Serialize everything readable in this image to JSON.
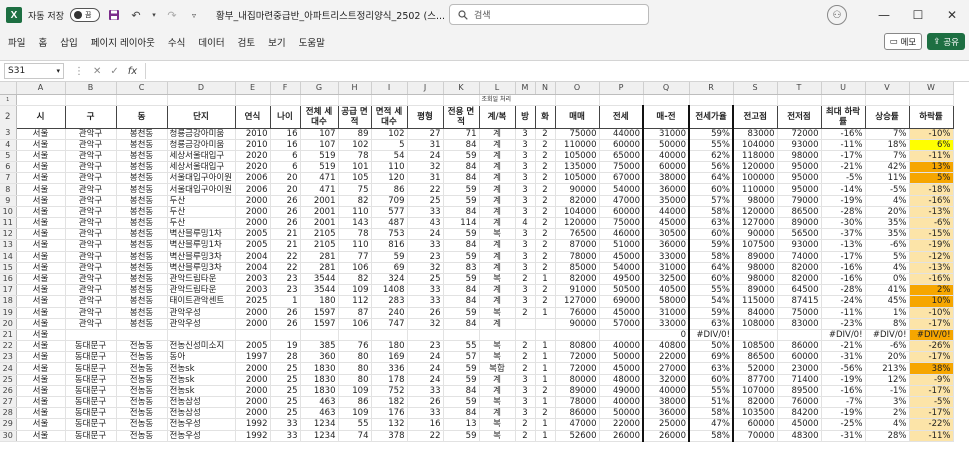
{
  "titlebar": {
    "app_icon": "X",
    "autosave_label": "자동 저장",
    "autosave_state": "끔",
    "doc_title": "황부_내집마련중급반_아파트리스트정리양식_2502 (스...",
    "search_placeholder": "검색"
  },
  "menu": [
    "파일",
    "홈",
    "삽입",
    "페이지 레이아웃",
    "수식",
    "데이터",
    "검토",
    "보기",
    "도움말"
  ],
  "menu_right": {
    "memo": "메모",
    "share": "공유"
  },
  "formula": {
    "namebox": "S31",
    "fx": "fx",
    "content": ""
  },
  "columns": [
    "A",
    "B",
    "C",
    "D",
    "E",
    "F",
    "G",
    "H",
    "I",
    "J",
    "K",
    "L",
    "M",
    "N",
    "O",
    "P",
    "Q",
    "R",
    "S",
    "T",
    "U",
    "V",
    "W"
  ],
  "partial_row1": "조회일 처리",
  "header_row": [
    "시",
    "구",
    "동",
    "단지",
    "연식",
    "나이",
    "전체 세대수",
    "공급 면적",
    "면적 세대수",
    "평형",
    "전용 면적",
    "계/복",
    "방",
    "화",
    "매매",
    "전세",
    "매-전",
    "전세가율",
    "전고점",
    "전저점",
    "최대 하락률",
    "상승률",
    "하락률"
  ],
  "rows": [
    {
      "n": "3",
      "v": [
        "서울",
        "관악구",
        "봉천동",
        "청룡금강아미움",
        "2010",
        "16",
        "107",
        "89",
        "102",
        "27",
        "71",
        "계",
        "3",
        "2",
        "75000",
        "44000",
        "31000",
        "59%",
        "83000",
        "72000",
        "-16%",
        "7%",
        "-10%"
      ]
    },
    {
      "n": "4",
      "v": [
        "서울",
        "관악구",
        "봉천동",
        "청룡금강아미움",
        "2010",
        "16",
        "107",
        "102",
        "5",
        "31",
        "84",
        "계",
        "3",
        "2",
        "110000",
        "60000",
        "50000",
        "55%",
        "104000",
        "93000",
        "-11%",
        "18%",
        "6%"
      ]
    },
    {
      "n": "5",
      "v": [
        "서울",
        "관악구",
        "봉천동",
        "세상서울대입구",
        "2020",
        "6",
        "519",
        "78",
        "54",
        "24",
        "59",
        "계",
        "3",
        "2",
        "105000",
        "65000",
        "40000",
        "62%",
        "118000",
        "98000",
        "-17%",
        "7%",
        "-11%"
      ]
    },
    {
      "n": "6",
      "v": [
        "서울",
        "관악구",
        "봉천동",
        "세상서울대입구",
        "2020",
        "6",
        "519",
        "101",
        "110",
        "32",
        "84",
        "계",
        "3",
        "2",
        "135000",
        "75000",
        "60000",
        "56%",
        "120000",
        "95000",
        "-21%",
        "42%",
        "13%"
      ]
    },
    {
      "n": "7",
      "v": [
        "서울",
        "관악구",
        "봉천동",
        "서울대입구아이원",
        "2006",
        "20",
        "471",
        "105",
        "120",
        "31",
        "84",
        "계",
        "3",
        "2",
        "105000",
        "67000",
        "38000",
        "64%",
        "100000",
        "95000",
        "-5%",
        "11%",
        "5%"
      ]
    },
    {
      "n": "8",
      "v": [
        "서울",
        "관악구",
        "봉천동",
        "서울대입구아이원",
        "2006",
        "20",
        "471",
        "75",
        "86",
        "22",
        "59",
        "계",
        "3",
        "2",
        "90000",
        "54000",
        "36000",
        "60%",
        "110000",
        "95000",
        "-14%",
        "-5%",
        "-18%"
      ]
    },
    {
      "n": "9",
      "v": [
        "서울",
        "관악구",
        "봉천동",
        "두산",
        "2000",
        "26",
        "2001",
        "82",
        "709",
        "25",
        "59",
        "계",
        "3",
        "2",
        "82000",
        "47000",
        "35000",
        "57%",
        "98000",
        "79000",
        "-19%",
        "4%",
        "-16%"
      ]
    },
    {
      "n": "10",
      "v": [
        "서울",
        "관악구",
        "봉천동",
        "두산",
        "2000",
        "26",
        "2001",
        "110",
        "577",
        "33",
        "84",
        "계",
        "3",
        "2",
        "104000",
        "60000",
        "44000",
        "58%",
        "120000",
        "86500",
        "-28%",
        "20%",
        "-13%"
      ]
    },
    {
      "n": "11",
      "v": [
        "서울",
        "관악구",
        "봉천동",
        "두산",
        "2000",
        "26",
        "2001",
        "143",
        "487",
        "43",
        "114",
        "계",
        "4",
        "2",
        "120000",
        "75000",
        "45000",
        "63%",
        "127000",
        "89000",
        "-30%",
        "35%",
        "-6%"
      ]
    },
    {
      "n": "12",
      "v": [
        "서울",
        "관악구",
        "봉천동",
        "벽산블루밍1차",
        "2005",
        "21",
        "2105",
        "78",
        "753",
        "24",
        "59",
        "복",
        "3",
        "2",
        "76500",
        "46000",
        "30500",
        "60%",
        "90000",
        "56500",
        "-37%",
        "35%",
        "-15%"
      ]
    },
    {
      "n": "13",
      "v": [
        "서울",
        "관악구",
        "봉천동",
        "벽산블루밍1차",
        "2005",
        "21",
        "2105",
        "110",
        "816",
        "33",
        "84",
        "계",
        "3",
        "2",
        "87000",
        "51000",
        "36000",
        "59%",
        "107500",
        "93000",
        "-13%",
        "-6%",
        "-19%"
      ]
    },
    {
      "n": "14",
      "v": [
        "서울",
        "관악구",
        "봉천동",
        "벽산블루밍3차",
        "2004",
        "22",
        "281",
        "77",
        "59",
        "23",
        "59",
        "계",
        "3",
        "2",
        "78000",
        "45000",
        "33000",
        "58%",
        "89000",
        "74000",
        "-17%",
        "5%",
        "-12%"
      ]
    },
    {
      "n": "15",
      "v": [
        "서울",
        "관악구",
        "봉천동",
        "벽산블루밍3차",
        "2004",
        "22",
        "281",
        "106",
        "69",
        "32",
        "83",
        "계",
        "3",
        "2",
        "85000",
        "54000",
        "31000",
        "64%",
        "98000",
        "82000",
        "-16%",
        "4%",
        "-13%"
      ]
    },
    {
      "n": "16",
      "v": [
        "서울",
        "관악구",
        "봉천동",
        "관악드림타운",
        "2003",
        "23",
        "3544",
        "82",
        "324",
        "25",
        "59",
        "복",
        "2",
        "1",
        "82000",
        "49500",
        "32500",
        "60%",
        "98000",
        "82000",
        "-16%",
        "0%",
        "-16%"
      ]
    },
    {
      "n": "17",
      "v": [
        "서울",
        "관악구",
        "봉천동",
        "관악드림타운",
        "2003",
        "23",
        "3544",
        "109",
        "1408",
        "33",
        "84",
        "계",
        "3",
        "2",
        "91000",
        "50500",
        "40500",
        "55%",
        "89000",
        "64500",
        "-28%",
        "41%",
        "2%"
      ]
    },
    {
      "n": "18",
      "v": [
        "서울",
        "관악구",
        "봉천동",
        "태이트관악센트",
        "2025",
        "1",
        "180",
        "112",
        "283",
        "33",
        "84",
        "계",
        "3",
        "2",
        "127000",
        "69000",
        "58000",
        "54%",
        "115000",
        "87415",
        "-24%",
        "45%",
        "10%"
      ]
    },
    {
      "n": "19",
      "v": [
        "서울",
        "관악구",
        "봉천동",
        "관악우성",
        "2000",
        "26",
        "1597",
        "87",
        "240",
        "26",
        "59",
        "복",
        "2",
        "1",
        "76000",
        "45000",
        "31000",
        "59%",
        "84000",
        "75000",
        "-11%",
        "1%",
        "-10%"
      ]
    },
    {
      "n": "20",
      "v": [
        "서울",
        "관악구",
        "봉천동",
        "관악우성",
        "2000",
        "26",
        "1597",
        "106",
        "747",
        "32",
        "84",
        "계",
        "",
        "",
        "90000",
        "57000",
        "33000",
        "63%",
        "108000",
        "83000",
        "-23%",
        "8%",
        "-17%"
      ]
    },
    {
      "n": "21",
      "v": [
        "서울",
        "",
        "",
        "",
        "",
        "",
        "",
        "",
        "",
        "",
        "",
        "",
        "",
        "",
        "",
        "",
        "0",
        "#DIV/0!",
        "",
        "",
        "#DIV/0!",
        "#DIV/0!",
        "#DIV/0!"
      ]
    },
    {
      "n": "22",
      "v": [
        "서울",
        "동대문구",
        "전농동",
        "전농신성미소지",
        "2005",
        "19",
        "385",
        "76",
        "180",
        "23",
        "55",
        "복",
        "2",
        "1",
        "80800",
        "40000",
        "40800",
        "50%",
        "108500",
        "86000",
        "-21%",
        "-6%",
        "-26%"
      ]
    },
    {
      "n": "23",
      "v": [
        "서울",
        "동대문구",
        "전농동",
        "동아",
        "1997",
        "28",
        "360",
        "80",
        "169",
        "24",
        "57",
        "복",
        "2",
        "1",
        "72000",
        "50000",
        "22000",
        "69%",
        "86500",
        "60000",
        "-31%",
        "20%",
        "-17%"
      ]
    },
    {
      "n": "24",
      "v": [
        "서울",
        "동대문구",
        "전농동",
        "전농sk",
        "2000",
        "25",
        "1830",
        "80",
        "336",
        "24",
        "59",
        "복합",
        "2",
        "1",
        "72000",
        "45000",
        "27000",
        "63%",
        "52000",
        "23000",
        "-56%",
        "213%",
        "38%"
      ]
    },
    {
      "n": "25",
      "v": [
        "서울",
        "동대문구",
        "전농동",
        "전농sk",
        "2000",
        "25",
        "1830",
        "80",
        "178",
        "24",
        "59",
        "계",
        "3",
        "1",
        "80000",
        "48000",
        "32000",
        "60%",
        "87700",
        "71400",
        "-19%",
        "12%",
        "-9%"
      ]
    },
    {
      "n": "26",
      "v": [
        "서울",
        "동대문구",
        "전농동",
        "전농sk",
        "2000",
        "25",
        "1830",
        "109",
        "752",
        "33",
        "84",
        "계",
        "3",
        "2",
        "89000",
        "49000",
        "40000",
        "55%",
        "107000",
        "89500",
        "-16%",
        "-1%",
        "-17%"
      ]
    },
    {
      "n": "27",
      "v": [
        "서울",
        "동대문구",
        "전농동",
        "전농삼성",
        "2000",
        "25",
        "463",
        "86",
        "182",
        "26",
        "59",
        "복",
        "3",
        "1",
        "78000",
        "40000",
        "38000",
        "51%",
        "82000",
        "76000",
        "-7%",
        "3%",
        "-5%"
      ]
    },
    {
      "n": "28",
      "v": [
        "서울",
        "동대문구",
        "전농동",
        "전농삼성",
        "2000",
        "25",
        "463",
        "109",
        "176",
        "33",
        "84",
        "계",
        "3",
        "2",
        "86000",
        "50000",
        "36000",
        "58%",
        "103500",
        "84200",
        "-19%",
        "2%",
        "-17%"
      ]
    },
    {
      "n": "29",
      "v": [
        "서울",
        "동대문구",
        "전농동",
        "전농우성",
        "1992",
        "33",
        "1234",
        "55",
        "132",
        "16",
        "13",
        "복",
        "2",
        "1",
        "47000",
        "22000",
        "25000",
        "47%",
        "60000",
        "45000",
        "-25%",
        "4%",
        "-22%"
      ]
    },
    {
      "n": "30",
      "v": [
        "서울",
        "동대문구",
        "전농동",
        "전농우성",
        "1992",
        "33",
        "1234",
        "74",
        "378",
        "22",
        "59",
        "복",
        "2",
        "1",
        "52600",
        "26000",
        "26000",
        "58%",
        "70000",
        "48300",
        "-31%",
        "28%",
        "-11%"
      ]
    }
  ]
}
